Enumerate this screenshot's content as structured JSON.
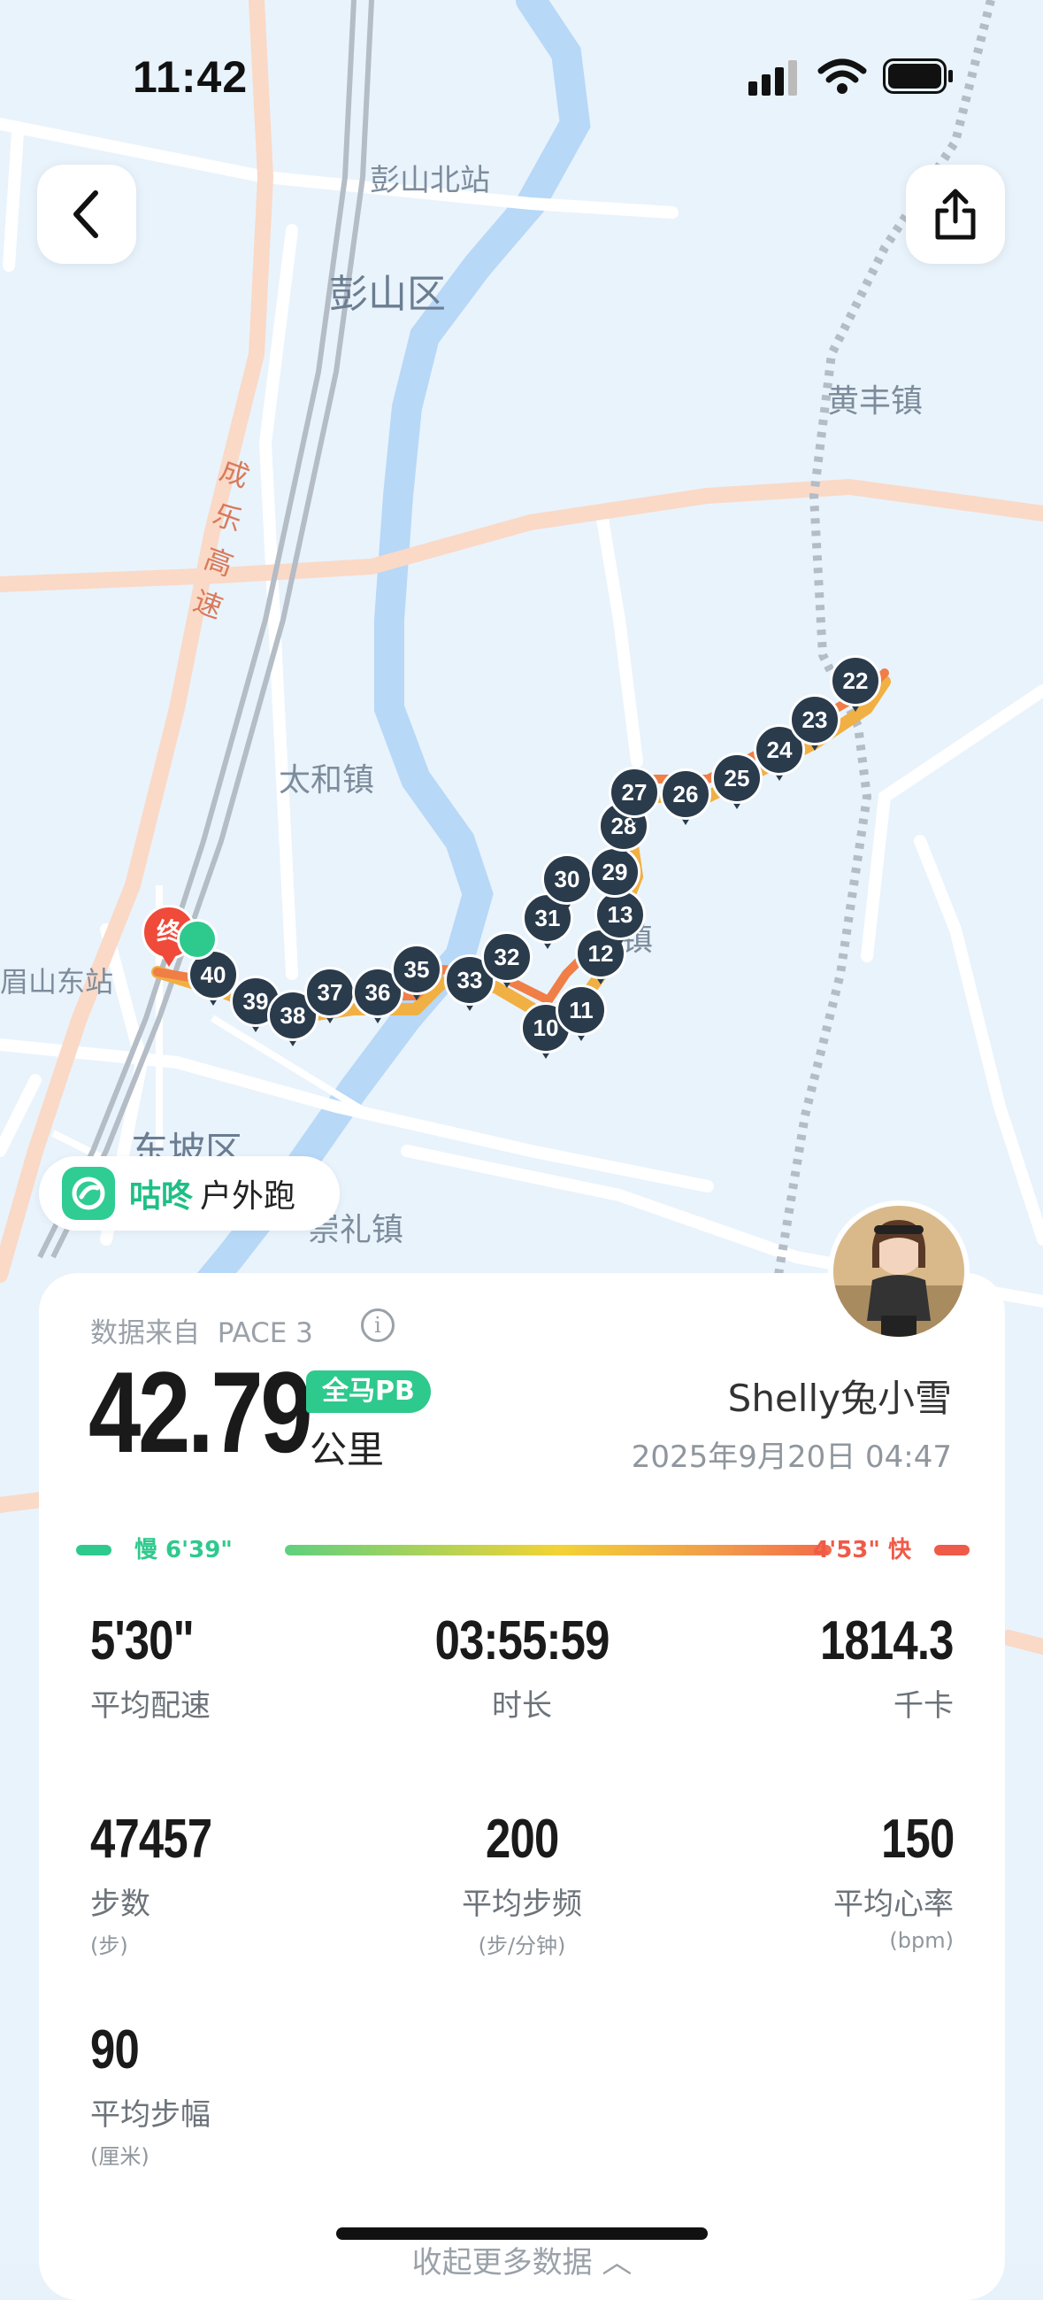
{
  "status": {
    "time": "11:42"
  },
  "map": {
    "labels": [
      {
        "id": "pengshan-north-station",
        "text": "彭山北站"
      },
      {
        "id": "pengshan-district",
        "text": "彭山区"
      },
      {
        "id": "huangfeng-town",
        "text": "黄丰镇"
      },
      {
        "id": "taihe-town",
        "text": "太和镇"
      },
      {
        "id": "meishan-east-station",
        "text": "眉山东站"
      },
      {
        "id": "dongpo-district",
        "text": "东坡区"
      },
      {
        "id": "chongli-town",
        "text": "崇礼镇"
      },
      {
        "id": "town-partial",
        "text": "镇"
      }
    ],
    "expressway_chars": [
      "成",
      "乐",
      "高",
      "速"
    ],
    "finish_marker": "终",
    "km_markers": [
      "40",
      "39",
      "38",
      "37",
      "36",
      "35",
      "33",
      "32",
      "10",
      "11",
      "12",
      "13",
      "31",
      "30",
      "29",
      "28",
      "27",
      "26",
      "25",
      "24",
      "23",
      "22"
    ],
    "colors": {
      "route_slow": "#f1b043",
      "route_fast": "#f07e47",
      "marker": "#2a3b4c",
      "finish": "#f04a3a",
      "water": "#b7d8f7",
      "road": "#fad9c7"
    }
  },
  "brand": {
    "name": "咕咚",
    "sub": "户外跑",
    "icon": "codoon-logo-icon"
  },
  "card": {
    "source_label": "数据来自",
    "source_device": "PACE 3",
    "distance": "42.79",
    "distance_unit": "公里",
    "pb_badge": "全马PB",
    "user_name": "Shelly兔小雪",
    "datetime": "2025年9月20日 04:47",
    "pace_slow": "慢 6'39\"",
    "pace_fast": "4'53\" 快",
    "stats": [
      {
        "id": "avg-pace",
        "value": "5'30\"",
        "label": "平均配速",
        "sub": ""
      },
      {
        "id": "duration",
        "value": "03:55:59",
        "label": "时长",
        "sub": ""
      },
      {
        "id": "calories",
        "value": "1814.3",
        "label": "千卡",
        "sub": ""
      },
      {
        "id": "steps",
        "value": "47457",
        "label": "步数",
        "sub": "(步)"
      },
      {
        "id": "avg-cadence",
        "value": "200",
        "label": "平均步频",
        "sub": "(步/分钟)"
      },
      {
        "id": "avg-heart-rate",
        "value": "150",
        "label": "平均心率",
        "sub": "(bpm)"
      },
      {
        "id": "avg-stride",
        "value": "90",
        "label": "平均步幅",
        "sub": "(厘米)"
      }
    ],
    "collapse_label": "收起更多数据"
  }
}
